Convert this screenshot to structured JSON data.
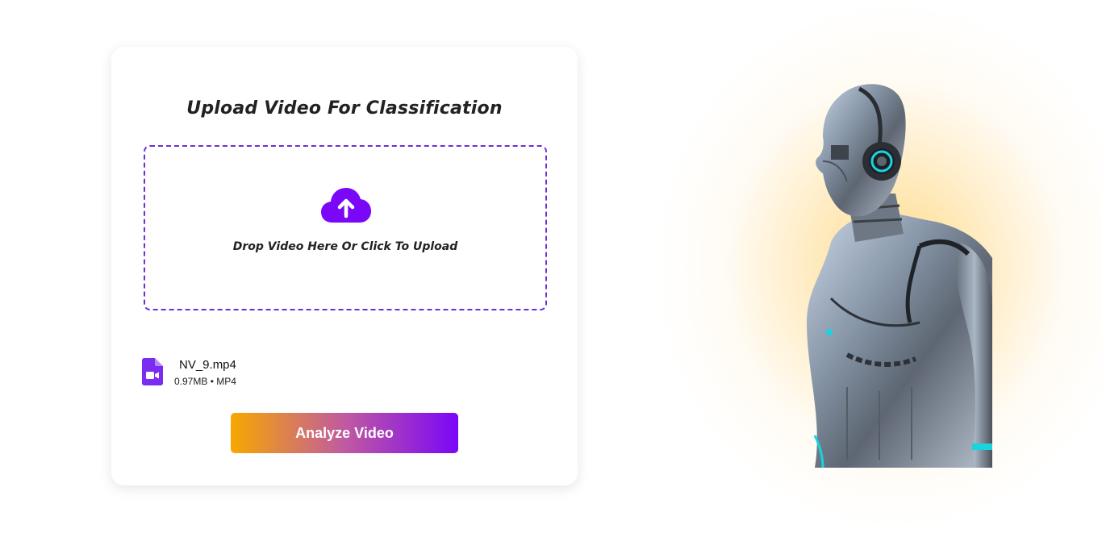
{
  "upload_card": {
    "title": "Upload Video For Classification",
    "dropzone": {
      "icon": "cloud-upload-icon",
      "label": "Drop Video Here Or Click To Upload"
    },
    "file": {
      "icon": "video-file-icon",
      "name": "NV_9.mp4",
      "meta": "0.97MB • MP4"
    },
    "analyze_button_label": "Analyze Video"
  },
  "colors": {
    "accent": "#7a07f7",
    "dropzone_border": "#6b2fd6",
    "button_gradient_start": "#f7a800",
    "button_gradient_end": "#7a07f7",
    "glow": "#ffc84a"
  },
  "hero": {
    "image": "robot-with-headphones-illustration"
  }
}
